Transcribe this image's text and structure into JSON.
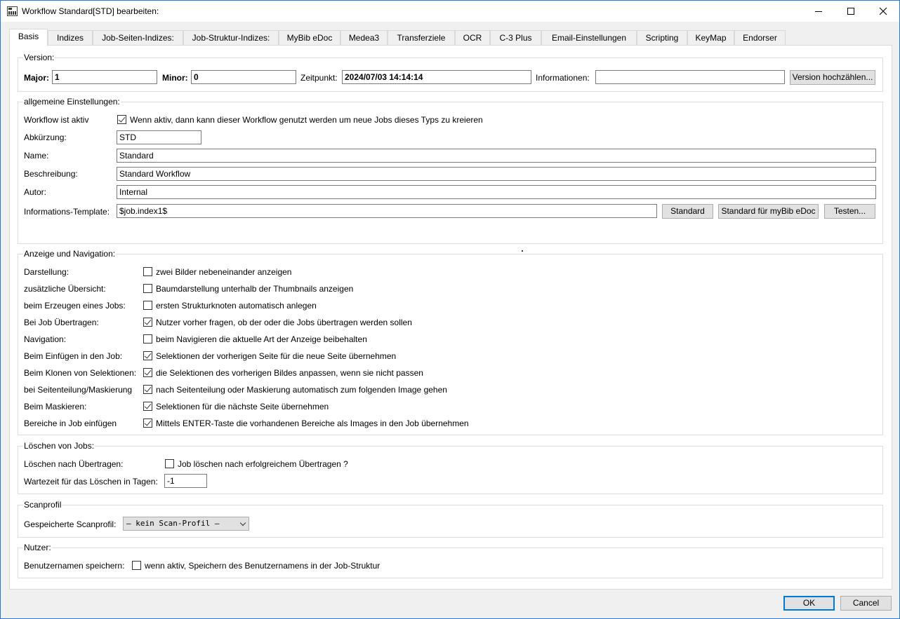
{
  "window": {
    "title": "Workflow Standard[STD] bearbeiten:"
  },
  "tabs": [
    "Basis",
    "Indizes",
    "Job-Seiten-Indizes:",
    "Job-Struktur-Indizes:",
    "MyBib eDoc",
    "Medea3",
    "Transferziele",
    "OCR",
    "C-3 Plus",
    "Email-Einstellungen",
    "Scripting",
    "KeyMap",
    "Endorser"
  ],
  "version": {
    "group": "Version:",
    "major_label": "Major:",
    "major_value": "1",
    "minor_label": "Minor:",
    "minor_value": "0",
    "time_label": "Zeitpunkt:",
    "time_value": "2024/07/03 14:14:14",
    "info_label": "Informationen:",
    "info_value": "",
    "increment_button": "Version hochzählen..."
  },
  "general": {
    "group": "allgemeine Einstellungen:",
    "active_label": "Workflow ist aktiv",
    "active_text": "Wenn aktiv, dann kann dieser Workflow genutzt werden um neue Jobs dieses Typs zu kreieren",
    "active_checked": true,
    "abbr_label": "Abkürzung:",
    "abbr_value": "STD",
    "name_label": "Name:",
    "name_value": "Standard",
    "desc_label": "Beschreibung:",
    "desc_value": "Standard Workflow",
    "author_label": "Autor:",
    "author_value": "Internal",
    "template_label": "Informations-Template:",
    "template_value": "$job.index1$",
    "btn_standard": "Standard",
    "btn_standard_mybib": "Standard für myBib eDoc",
    "btn_test": "Testen..."
  },
  "display": {
    "group": "Anzeige und Navigation:",
    "rows": [
      {
        "label": "Darstellung:",
        "text": "zwei Bilder nebeneinander anzeigen",
        "checked": false
      },
      {
        "label": "zusätzliche Übersicht:",
        "text": "Baumdarstellung unterhalb der Thumbnails anzeigen",
        "checked": false
      },
      {
        "label": "beim Erzeugen eines Jobs:",
        "text": "ersten Strukturknoten automatisch anlegen",
        "checked": false
      },
      {
        "label": "Bei Job Übertragen:",
        "text": "Nutzer vorher fragen, ob der oder die Jobs übertragen werden sollen",
        "checked": true
      },
      {
        "label": "Navigation:",
        "text": "beim Navigieren die aktuelle Art der Anzeige beibehalten",
        "checked": false
      },
      {
        "label": "Beim Einfügen in den Job:",
        "text": "Selektionen der vorherigen Seite für die neue Seite übernehmen",
        "checked": true
      },
      {
        "label": "Beim Klonen von Selektionen:",
        "text": "die Selektionen des vorherigen Bildes anpassen, wenn sie nicht passen",
        "checked": true
      },
      {
        "label": "bei Seitenteilung/Maskierung",
        "text": "nach Seitenteilung oder Maskierung automatisch zum folgenden Image gehen",
        "checked": true
      },
      {
        "label": "Beim Maskieren:",
        "text": "Selektionen  für die nächste Seite übernehmen",
        "checked": true
      },
      {
        "label": "Bereiche in Job einfügen",
        "text": "Mittels ENTER-Taste die vorhandenen Bereiche als Images in den Job übernehmen",
        "checked": true
      }
    ]
  },
  "delete": {
    "group": "Löschen von Jobs:",
    "after_label": "Löschen nach Übertragen:",
    "after_text": "Job löschen nach erfolgreichem Übertragen ?",
    "after_checked": false,
    "wait_label": "Wartezeit für das Löschen in Tagen:",
    "wait_value": "-1"
  },
  "scan": {
    "group": "Scanprofil",
    "label": "Gespeicherte Scanprofil:",
    "selected": "– kein Scan-Profil –"
  },
  "user": {
    "group": "Nutzer:",
    "label": "Benutzernamen speichern:",
    "text": "wenn aktiv, Speichern des Benutzernamens in der Job-Struktur",
    "checked": false
  },
  "footer": {
    "ok": "OK",
    "cancel": "Cancel"
  }
}
